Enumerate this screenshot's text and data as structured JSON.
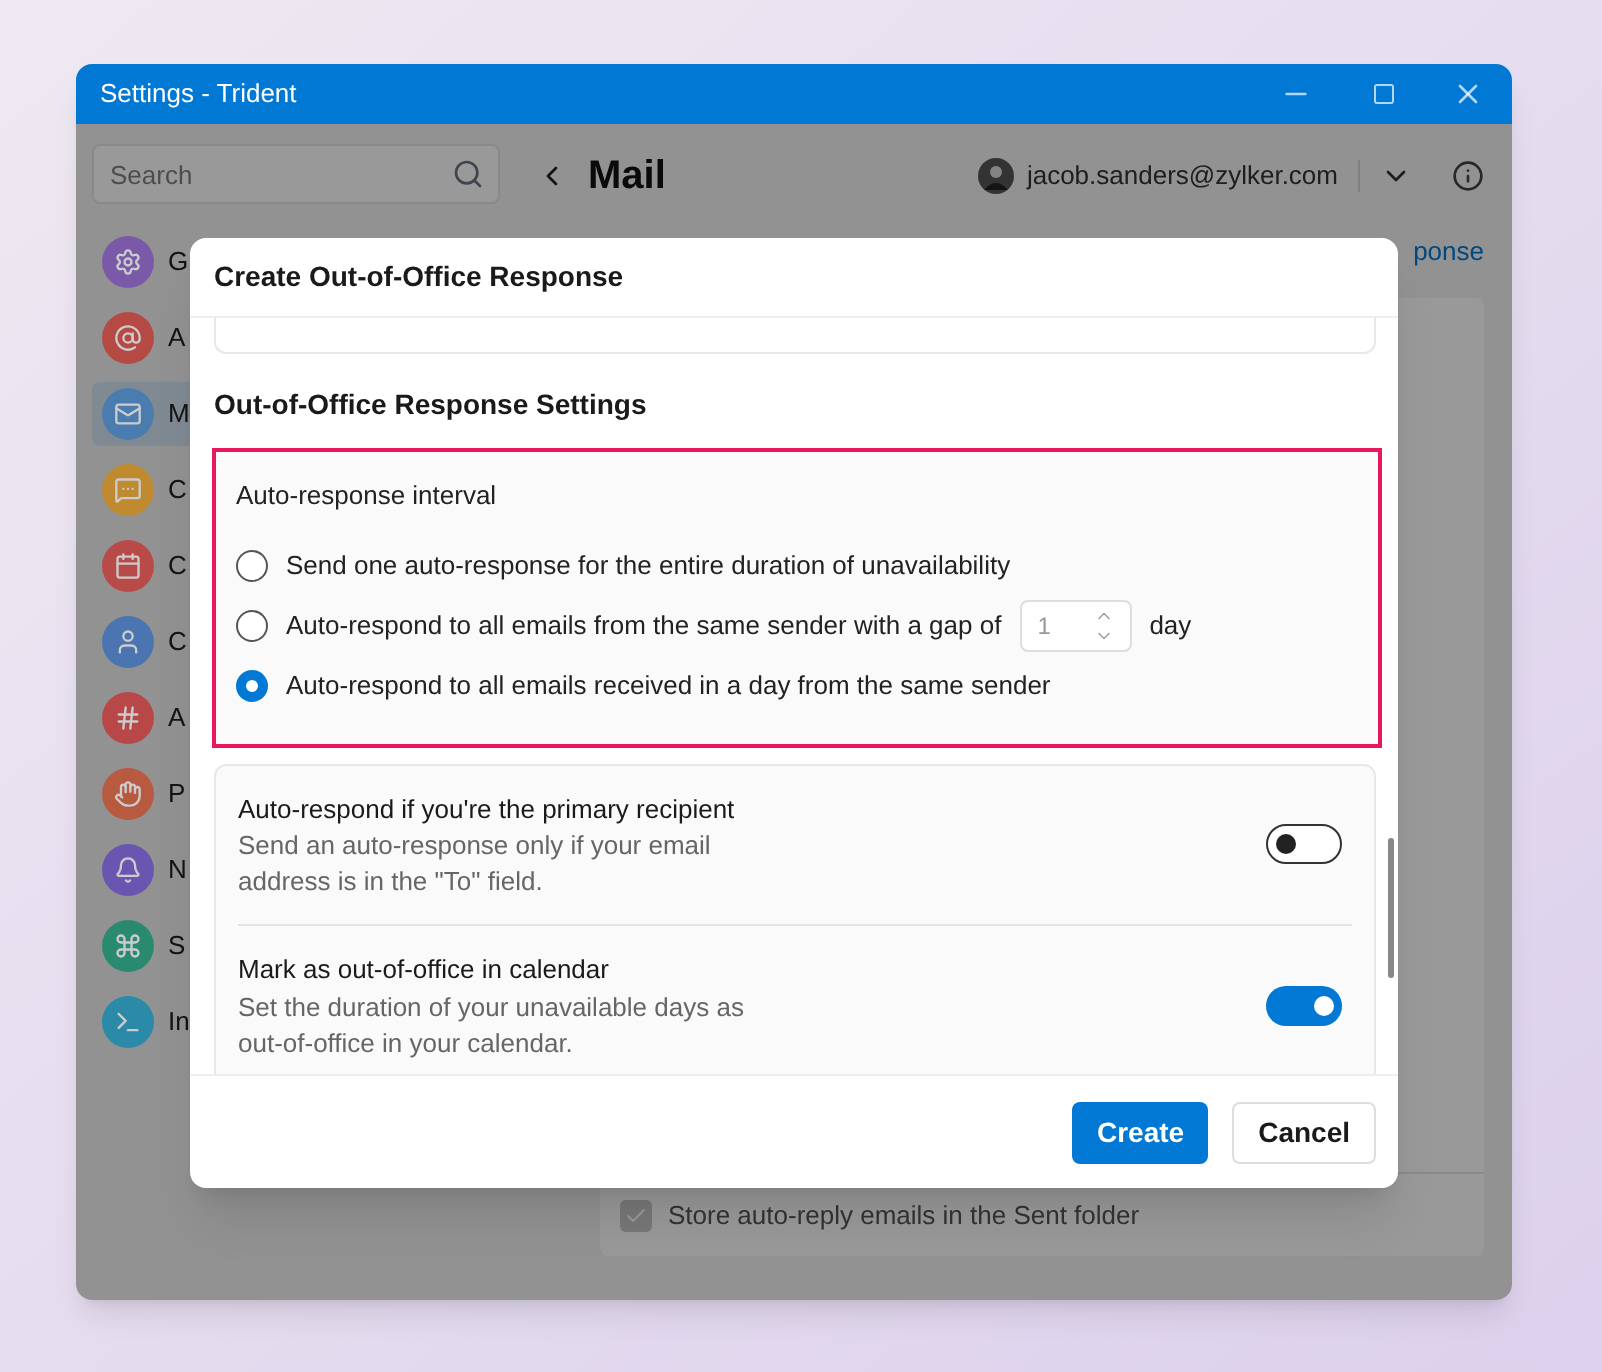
{
  "window": {
    "title": "Settings - Trident"
  },
  "search": {
    "placeholder": "Search"
  },
  "sidebar": {
    "items": [
      {
        "label": "G",
        "color": "#7a5aa8",
        "selected": false
      },
      {
        "label": "A",
        "color": "#b54a45",
        "selected": false
      },
      {
        "label": "M",
        "color": "#4a7cb0",
        "selected": true
      },
      {
        "label": "C",
        "color": "#c08a30",
        "selected": false
      },
      {
        "label": "C",
        "color": "#b84a48",
        "selected": false
      },
      {
        "label": "C",
        "color": "#4a75b0",
        "selected": false
      },
      {
        "label": "A",
        "color": "#b84848",
        "selected": false
      },
      {
        "label": "P",
        "color": "#b85a40",
        "selected": false
      },
      {
        "label": "N",
        "color": "#6a55b0",
        "selected": false
      },
      {
        "label": "S",
        "color": "#2a8a70",
        "selected": false
      },
      {
        "label": "In",
        "color": "#2a8aa8",
        "selected": false
      }
    ]
  },
  "header": {
    "title": "Mail",
    "account": "jacob.sanders@zylker.com",
    "link": "ponse"
  },
  "background_option": {
    "label": "Store auto-reply emails in the Sent folder",
    "checked": true
  },
  "dialog": {
    "title": "Create Out-of-Office Response",
    "section_title": "Out-of-Office Response Settings",
    "interval": {
      "label": "Auto-response interval",
      "options": [
        {
          "kind": "plain",
          "label": "Send one auto-response for the entire duration of unavailability",
          "selected": false
        },
        {
          "kind": "gap",
          "label": "Auto-respond to all emails from the same sender with a gap of",
          "value": "1",
          "unit": "day",
          "selected": false
        },
        {
          "kind": "plain",
          "label": "Auto-respond to all emails received in a day from the same sender",
          "selected": true
        }
      ]
    },
    "toggles": [
      {
        "title": "Auto-respond if you're the primary recipient",
        "description": "Send an auto-response only if your email address is in the \"To\" field.",
        "on": false
      },
      {
        "title": "Mark as out-of-office in calendar",
        "description": "Set the duration of your unavailable days as out-of-office in your calendar.",
        "on": true
      }
    ],
    "buttons": [
      {
        "kind": "primary",
        "label": "Create"
      },
      {
        "kind": "secondary",
        "label": "Cancel"
      }
    ]
  }
}
